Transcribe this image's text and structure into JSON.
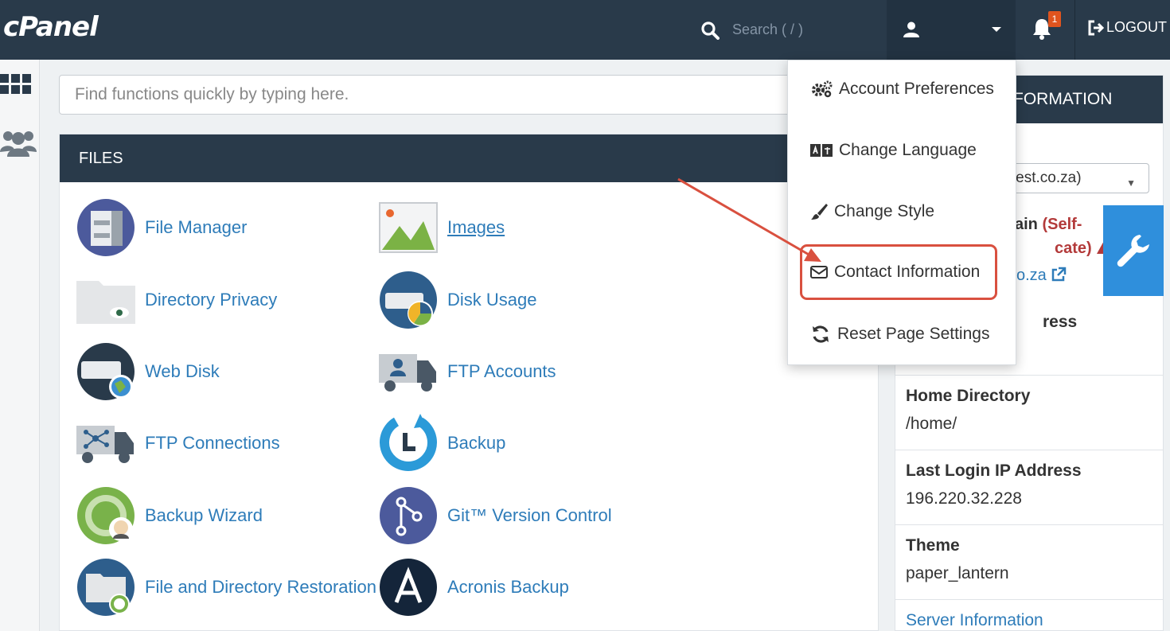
{
  "app": {
    "logo": "cPanel"
  },
  "topbar": {
    "search_placeholder": "Search ( / )",
    "notification_count": "1",
    "logout_label": "LOGOUT"
  },
  "quick_search": {
    "placeholder": "Find functions quickly by typing here."
  },
  "files": {
    "title": "FILES",
    "items": [
      {
        "label": "File Manager",
        "icon": "file-manager-icon"
      },
      {
        "label": "Images",
        "icon": "images-icon"
      },
      {
        "label": "Directory Privacy",
        "icon": "directory-privacy-icon"
      },
      {
        "label": "Disk Usage",
        "icon": "disk-usage-icon"
      },
      {
        "label": "Web Disk",
        "icon": "web-disk-icon"
      },
      {
        "label": "FTP Accounts",
        "icon": "ftp-accounts-icon"
      },
      {
        "label": "FTP Connections",
        "icon": "ftp-connections-icon"
      },
      {
        "label": "Backup",
        "icon": "backup-icon"
      },
      {
        "label": "Backup Wizard",
        "icon": "backup-wizard-icon"
      },
      {
        "label": "Git™ Version Control",
        "icon": "git-icon"
      },
      {
        "label": "File and Directory Restoration",
        "icon": "file-restoration-icon"
      },
      {
        "label": "Acronis Backup",
        "icon": "acronis-icon"
      }
    ]
  },
  "user_menu": {
    "items": [
      {
        "label": "Account Preferences",
        "icon": "gears-icon"
      },
      {
        "label": "Change Language",
        "icon": "language-icon"
      },
      {
        "label": "Change Style",
        "icon": "brush-icon"
      },
      {
        "label": "Contact Information",
        "icon": "envelope-icon"
      },
      {
        "label": "Reset Page Settings",
        "icon": "refresh-icon"
      }
    ]
  },
  "info_panel": {
    "title_partial": "FORMATION",
    "domain_select_partial": "d-test.co.za)",
    "main_domain_partial_1": "ain",
    "main_domain_warning_1": "(Self-",
    "main_domain_warning_2": "cate)",
    "domain_link_partial": "o.za",
    "address_partial": "ress",
    "home_directory_label": "Home Directory",
    "home_directory_value": "/home/",
    "last_login_label": "Last Login IP Address",
    "last_login_value": "196.220.32.228",
    "theme_label": "Theme",
    "theme_value": "paper_lantern",
    "server_info_link": "Server Information"
  }
}
